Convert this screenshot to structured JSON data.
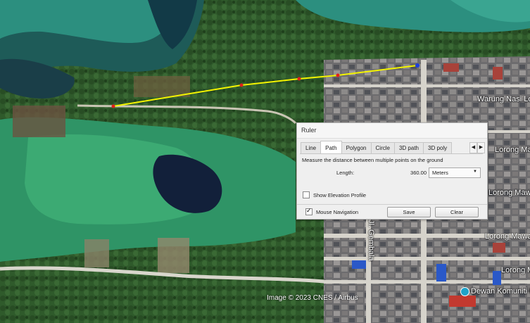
{
  "map": {
    "labels": {
      "warung": "Warung Nasi Lo",
      "lorong1": "Lorong Mawa",
      "lorong2": "Lorong Mawar",
      "lorong3": "Lorong Mawar",
      "lorong4": "Lorong Mawa",
      "jalan": "Jl. Gembala",
      "dewan": "Dewan Komuniti K"
    },
    "attribution": "Image © 2023 CNES / Airbus",
    "path_color": "#f4f400",
    "point_color": "#e0201a",
    "end_point_color": "#1d3fd9"
  },
  "ruler": {
    "title": "Ruler",
    "tabs": [
      "Line",
      "Path",
      "Polygon",
      "Circle",
      "3D path",
      "3D poly"
    ],
    "active_tab": "Path",
    "description": "Measure the distance between multiple points on the ground",
    "length_label": "Length:",
    "length_value": "360.00",
    "unit": "Meters",
    "show_elevation_label": "Show Elevation Profile",
    "show_elevation_checked": false,
    "mouse_nav_label": "Mouse Navigation",
    "mouse_nav_checked": true,
    "save_label": "Save",
    "clear_label": "Clear"
  }
}
